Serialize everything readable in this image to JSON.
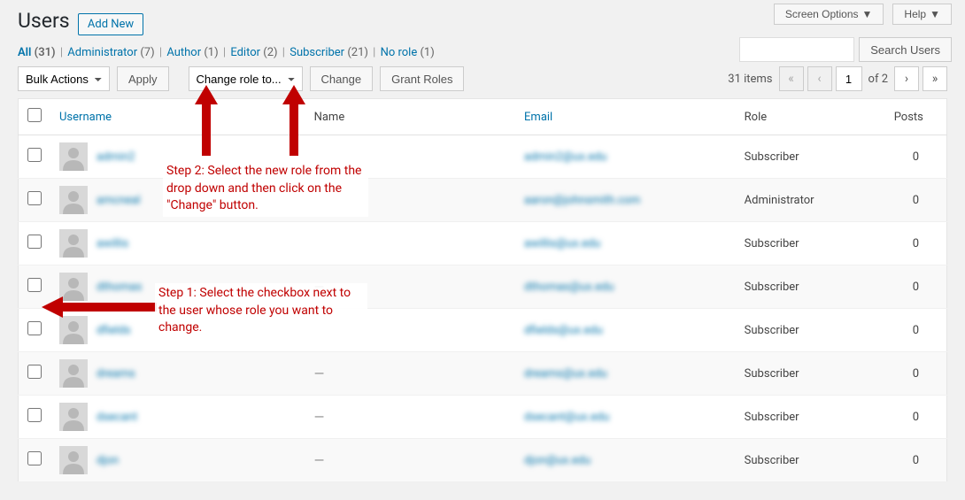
{
  "topMeta": {
    "screenOptions": "Screen Options",
    "help": "Help"
  },
  "page": {
    "title": "Users",
    "addNew": "Add New",
    "searchBtn": "Search Users"
  },
  "filters": {
    "all": {
      "label": "All",
      "count": "(31)"
    },
    "items": [
      {
        "label": "Administrator",
        "count": "(7)"
      },
      {
        "label": "Author",
        "count": "(1)"
      },
      {
        "label": "Editor",
        "count": "(2)"
      },
      {
        "label": "Subscriber",
        "count": "(21)"
      },
      {
        "label": "No role",
        "count": "(1)"
      }
    ]
  },
  "actions": {
    "bulk": "Bulk Actions",
    "apply": "Apply",
    "changeRole": "Change role to...",
    "change": "Change",
    "grantRoles": "Grant Roles"
  },
  "pagination": {
    "itemsText": "31 items",
    "current": "1",
    "ofText": "of 2"
  },
  "columns": {
    "username": "Username",
    "name": "Name",
    "email": "Email",
    "role": "Role",
    "posts": "Posts"
  },
  "rows": [
    {
      "username": "admin2",
      "name": "",
      "email": "admin2@ux.edu",
      "role": "Subscriber",
      "posts": "0"
    },
    {
      "username": "amcneal",
      "name": "",
      "email": "aaron@johnsmith.com",
      "role": "Administrator",
      "posts": "0"
    },
    {
      "username": "awillis",
      "name": "",
      "email": "awillis@ux.edu",
      "role": "Subscriber",
      "posts": "0"
    },
    {
      "username": "dthomas",
      "name": "—",
      "email": "dthomas@ux.edu",
      "role": "Subscriber",
      "posts": "0"
    },
    {
      "username": "dfields",
      "name": "",
      "email": "dfields@ux.edu",
      "role": "Subscriber",
      "posts": "0"
    },
    {
      "username": "dreams",
      "name": "—",
      "email": "dreams@ux.edu",
      "role": "Subscriber",
      "posts": "0"
    },
    {
      "username": "dsecant",
      "name": "—",
      "email": "dsecant@ux.edu",
      "role": "Subscriber",
      "posts": "0"
    },
    {
      "username": "djon",
      "name": "—",
      "email": "djon@ux.edu",
      "role": "Subscriber",
      "posts": "0"
    }
  ],
  "annotations": {
    "step1": "Step 1: Select the checkbox next to the user whose role you want to change.",
    "step2": "Step 2: Select the new role from the drop down and then click on the \"Change\" button."
  }
}
